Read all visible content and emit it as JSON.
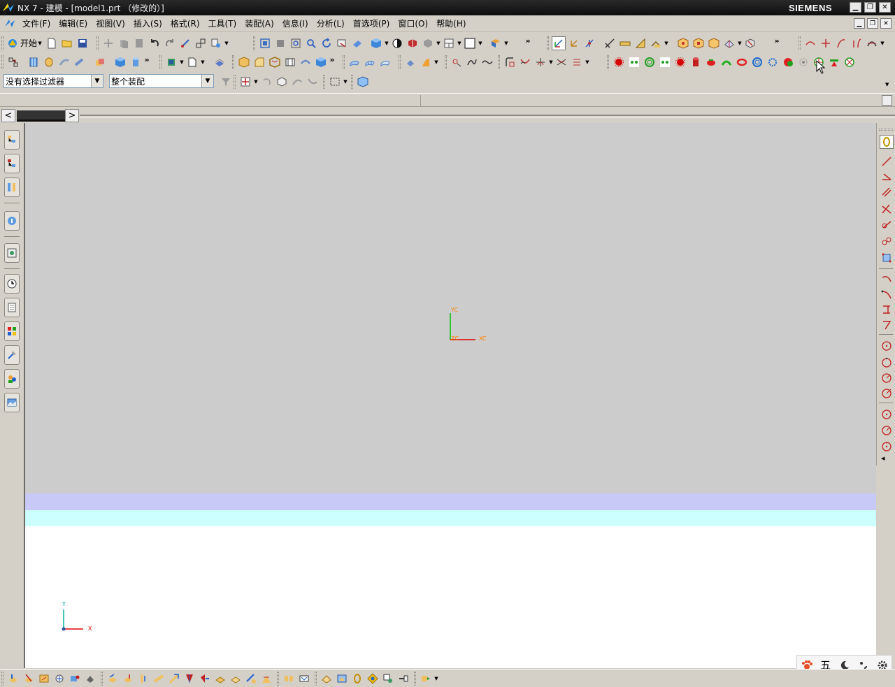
{
  "window": {
    "title": "NX 7 - 建模 - [model1.prt （修改的）]",
    "brand": "SIEMENS",
    "controls": [
      "minimize",
      "restore",
      "close"
    ]
  },
  "menu": {
    "items": [
      "文件(F)",
      "编辑(E)",
      "视图(V)",
      "插入(S)",
      "格式(R)",
      "工具(T)",
      "装配(A)",
      "信息(I)",
      "分析(L)",
      "首选项(P)",
      "窗口(O)",
      "帮助(H)"
    ]
  },
  "toolbar_standard": {
    "start_label": "开始"
  },
  "selection_bar": {
    "filter_value": "没有选择过滤器",
    "scope_value": "整个装配"
  },
  "viewport": {
    "wcs_x_label": "XC",
    "wcs_y_label": "YC",
    "wcs_z_label": "ZC",
    "abs_x_label": "X",
    "abs_y_label": "Y"
  },
  "ime": {
    "mode_label": "五"
  },
  "colors": {
    "titlebar": "#111111",
    "viewport_gray": "#cccccc",
    "band_lavender": "#c9c9f7",
    "band_cyan": "#ccffff",
    "axis_x": "#e00000",
    "axis_y": "#00c000",
    "wcs_label": "#ff8000"
  }
}
